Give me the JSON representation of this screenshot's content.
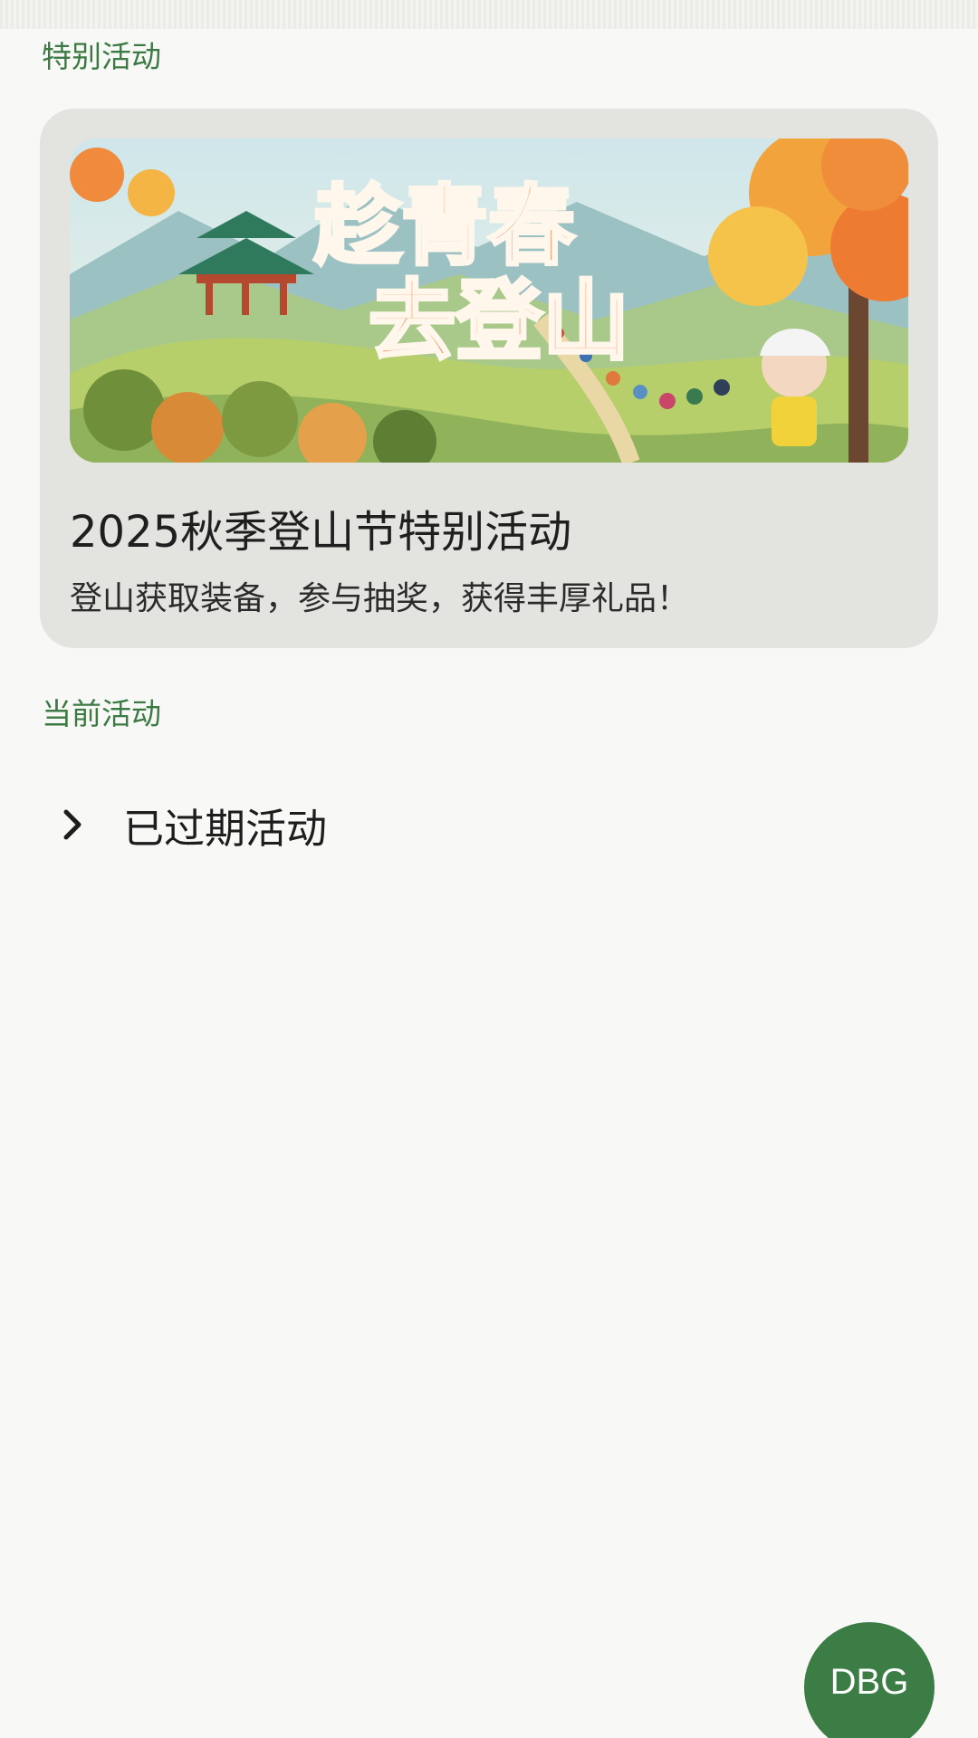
{
  "sections": {
    "special": "特别活动",
    "current": "当前活动"
  },
  "event": {
    "banner_text": "趁青春去登山",
    "title": "2025秋季登山节特别活动",
    "description": "登山获取装备，参与抽奖，获得丰厚礼品！"
  },
  "expired": {
    "label": "已过期活动"
  },
  "fab": {
    "label": "DBG",
    "color": "#3b7d45"
  },
  "colors": {
    "accent": "#3c7a43",
    "background": "#f8f8f6",
    "card": "#e3e3e0"
  }
}
